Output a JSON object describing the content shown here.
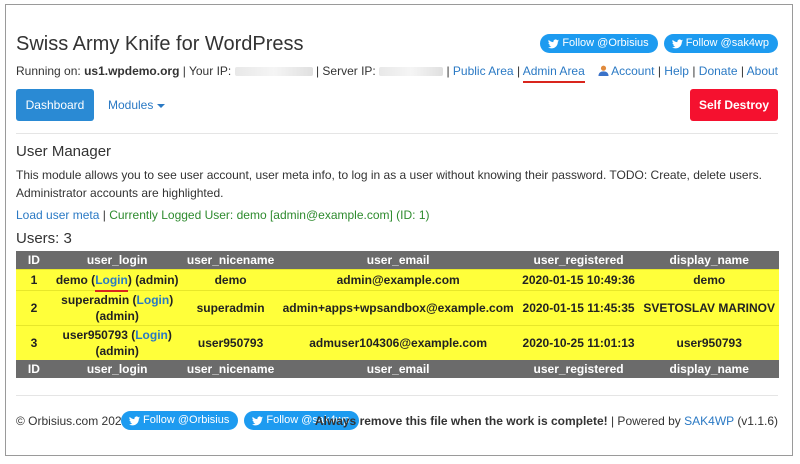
{
  "header": {
    "title": "Swiss Army Knife for WordPress",
    "twitter_buttons": [
      "Follow @Orbisius",
      "Follow @sak4wp"
    ]
  },
  "runbar": {
    "running_on_label": "Running on:",
    "host": "us1.wpdemo.org",
    "your_ip_label": "| Your IP:",
    "server_ip_label": "| Server IP:",
    "public_area": "Public Area",
    "admin_area": "Admin Area",
    "sep": "|"
  },
  "account": {
    "account": "Account",
    "help": "Help",
    "donate": "Donate",
    "about": "About"
  },
  "nav": {
    "dashboard": "Dashboard",
    "modules": "Modules",
    "self_destroy": "Self Destroy"
  },
  "main": {
    "section_title": "User Manager",
    "description": "This module allows you to see user account, user meta info, to log in as a user without knowing their password. TODO: Create, delete users. Administrator accounts are highlighted.",
    "load_user_meta": "Load user meta",
    "sep": "|",
    "logged_user": "Currently Logged User: demo [admin@example.com] (ID: 1)",
    "users_count": "Users: 3"
  },
  "table": {
    "headers": [
      "ID",
      "user_login",
      "user_nicename",
      "user_email",
      "user_registered",
      "display_name"
    ],
    "login_link": "Login",
    "rows": [
      {
        "id": "1",
        "login": "demo",
        "role": "(admin)",
        "nicename": "demo",
        "email": "admin@example.com",
        "registered": "2020-01-15 10:49:36",
        "display": "demo"
      },
      {
        "id": "2",
        "login": "superadmin",
        "role": "(admin)",
        "nicename": "superadmin",
        "email": "admin+apps+wpsandbox@example.com",
        "registered": "2020-01-15 11:45:35",
        "display": "SVETOSLAV MARINOV"
      },
      {
        "id": "3",
        "login": "user950793",
        "role": "(admin)",
        "nicename": "user950793",
        "email": "admuser104306@example.com",
        "registered": "2020-10-25 11:01:13",
        "display": "user950793"
      }
    ]
  },
  "footer": {
    "copyright": "© Orbisius.com 2022",
    "twitter_buttons": [
      "Follow @Orbisius",
      "Follow @sak4wp"
    ],
    "warning": "Always remove this file when the work is complete!",
    "powered_by": "| Powered by",
    "sak4wp": "SAK4WP",
    "version": "(v1.1.6)"
  },
  "colors": {
    "accent": "#2a8ad4",
    "danger": "#f5112f",
    "highlight": "#ffff3a",
    "twitter": "#1d9bf0"
  }
}
